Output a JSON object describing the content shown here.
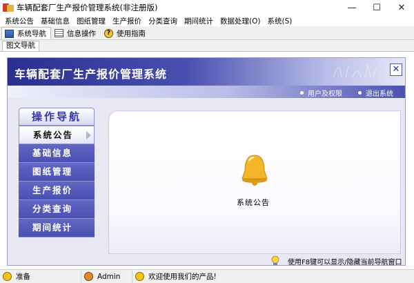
{
  "window": {
    "title": "车辆配套厂生产报价管理系统(非注册版)",
    "controls": [
      "—",
      "☐",
      "✕"
    ]
  },
  "menu": [
    "系统公告",
    "基础信息",
    "图纸管理",
    "生产报价",
    "分类查询",
    "期间统计",
    "数据处理(O)",
    "系统(S)"
  ],
  "toolbar": {
    "tabs": [
      {
        "label": "系统导航",
        "icon": "navigation-icon"
      },
      {
        "label": "信息操作",
        "icon": "info-list-icon"
      },
      {
        "label": "使用指南",
        "icon": "help-icon"
      }
    ]
  },
  "subtab": {
    "label": "图文导航"
  },
  "banner": {
    "title": "车辆配套厂生产报价管理系统",
    "close": "✕"
  },
  "navbar": {
    "links": [
      "用户及权限",
      "退出系统"
    ]
  },
  "sidebar": {
    "header": "操作导航",
    "items": [
      "系统公告",
      "基础信息",
      "图纸管理",
      "生产报价",
      "分类查询",
      "期间统计"
    ]
  },
  "content": {
    "label": "系统公告"
  },
  "footer": {
    "hint": "使用F8键可以显示/隐藏当前导航窗口"
  },
  "statusbar": {
    "ready": "准备",
    "user": "Admin",
    "welcome": "欢迎使用我们的产品!"
  }
}
